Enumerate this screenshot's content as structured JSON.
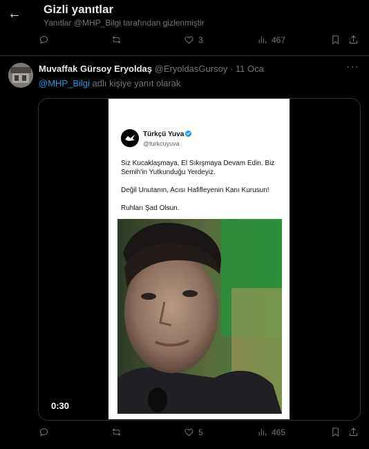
{
  "header": {
    "title": "Gizli yanıtlar",
    "subtitle": "Yanıtlar @MHP_Bilgi tarafından gizlenmiştir"
  },
  "top_actions": {
    "reply_count": "",
    "repost_count": "",
    "like_count": "3",
    "view_count": "467"
  },
  "tweet": {
    "author_name": "Muvaffak Gürsoy Eryoldaş",
    "author_handle": "@EryoldasGursoy",
    "separator": "·",
    "date": "11 Oca",
    "replying_to": "@MHP_Bilgi",
    "replying_suffix": "adlı kişiye yanıt olarak",
    "media": {
      "card_name": "Türkçü Yuva",
      "card_handle": "@turkcuyuva",
      "card_lines": [
        "Siz Kucaklaşmaya, El Sıkışmaya Devam Edin. Biz",
        "Semih'in Yutkunduğu Yerdeyiz.",
        "Değil Unutanın, Acısı Hafifleyenin Kanı Kurusun!",
        "Ruhları Şad Olsun."
      ],
      "duration": "0:30"
    },
    "actions": {
      "reply_count": "",
      "repost_count": "",
      "like_count": "5",
      "view_count": "465"
    }
  },
  "colors": {
    "background": "#000000",
    "text": "#e7e9ea",
    "muted": "#71767b",
    "accent": "#1d9bf0",
    "divider": "#2f3336"
  }
}
